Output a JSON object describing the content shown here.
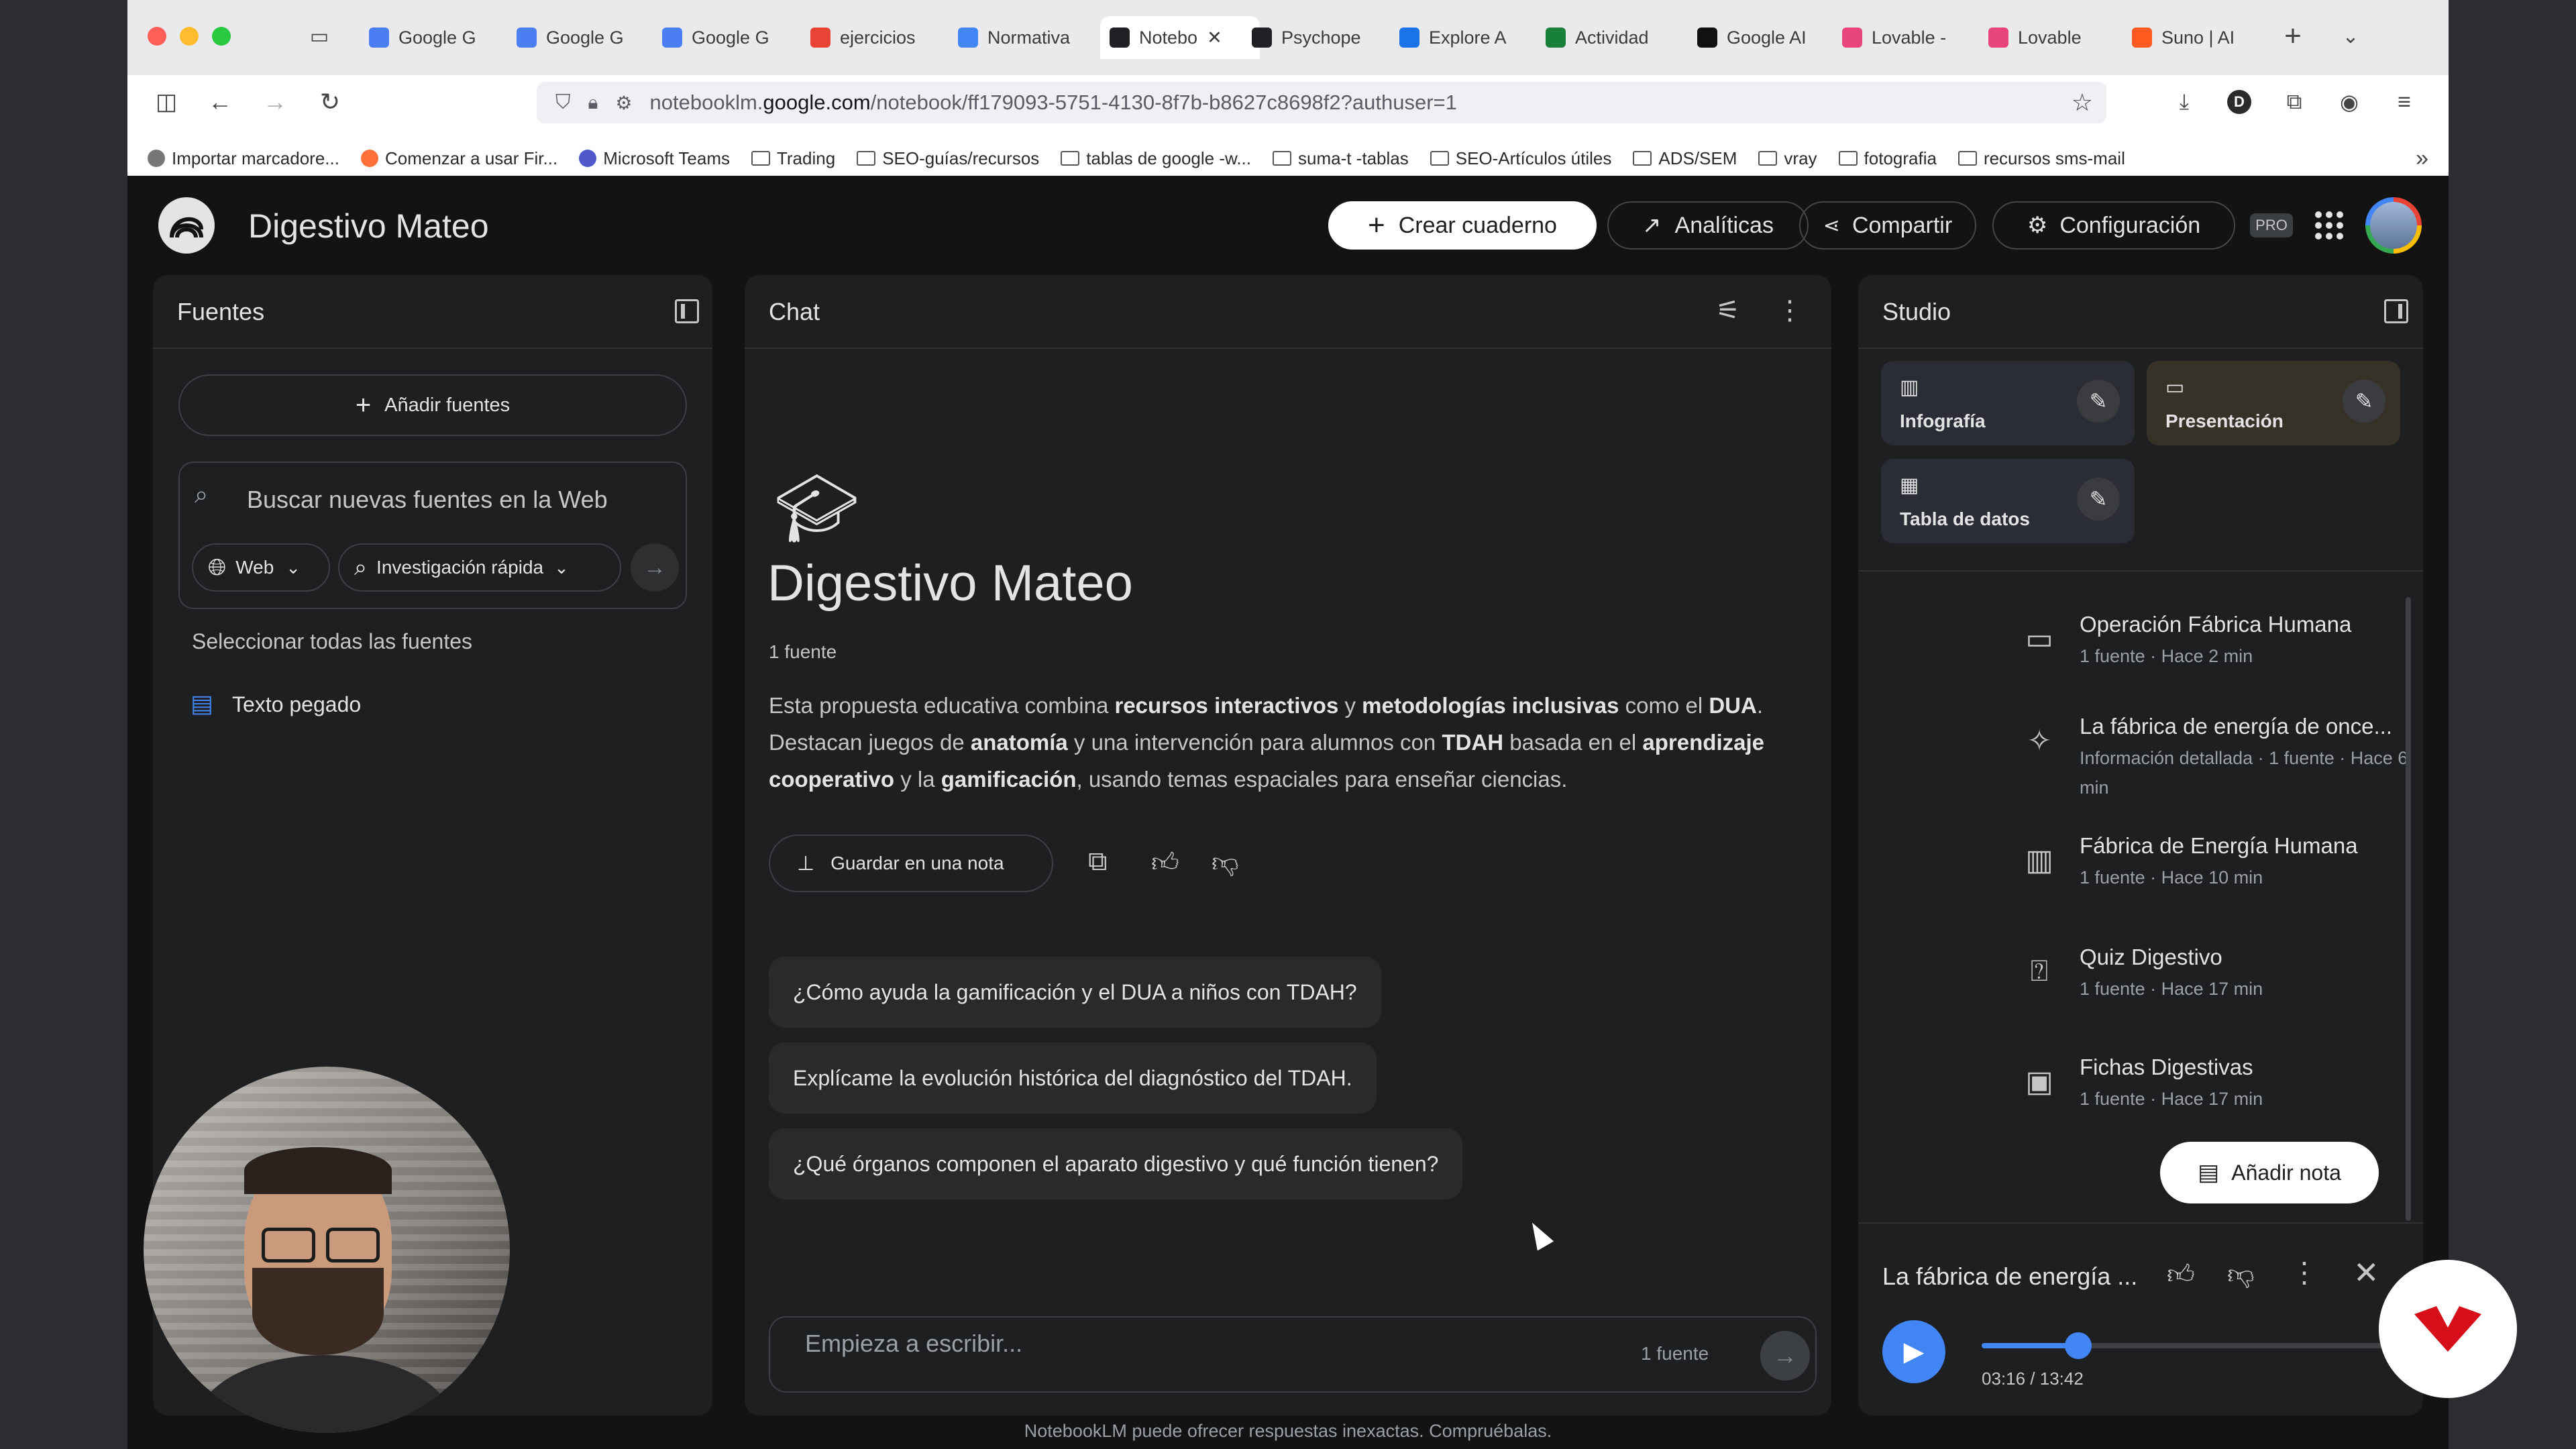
{
  "browser": {
    "tabs": [
      {
        "label": "Google G",
        "icon": "gemini-icon",
        "color": "#4c7ef3"
      },
      {
        "label": "Google G",
        "icon": "gemini-icon",
        "color": "#4c7ef3"
      },
      {
        "label": "Google G",
        "icon": "gemini-icon",
        "color": "#4c7ef3"
      },
      {
        "label": "ejercicios",
        "icon": "google-icon",
        "color": "#ea4335"
      },
      {
        "label": "Normativa",
        "icon": "docs-icon",
        "color": "#4285f4"
      },
      {
        "label": "Notebo",
        "icon": "notebooklm-icon",
        "color": "#202124"
      },
      {
        "label": "Psychope",
        "icon": "notebooklm-icon",
        "color": "#202124"
      },
      {
        "label": "Explore A",
        "icon": "forms-icon",
        "color": "#1a73e8"
      },
      {
        "label": "Actividad",
        "icon": "sheets-icon",
        "color": "#188038"
      },
      {
        "label": "Google AI",
        "icon": "ai-studio-icon",
        "color": "#111111"
      },
      {
        "label": "Lovable -",
        "icon": "lovable-icon",
        "color": "#e8457c"
      },
      {
        "label": "Lovable",
        "icon": "lovable-icon",
        "color": "#e8457c"
      },
      {
        "label": "Suno | AI",
        "icon": "suno-icon",
        "color": "#ff5a1f"
      }
    ],
    "url_prefix": "notebooklm.",
    "url_domain": "google.com",
    "url_path": "/notebook/ff179093-5751-4130-8f7b-b8627c8698f2?authuser=1",
    "profile_letter": "D",
    "bookmarks": [
      {
        "label": "Importar marcadore...",
        "icon": "import-icon"
      },
      {
        "label": "Comenzar a usar Fir...",
        "icon": "firefox-icon"
      },
      {
        "label": "Microsoft Teams",
        "icon": "teams-icon"
      },
      {
        "label": "Trading",
        "icon": "folder-icon"
      },
      {
        "label": "SEO-guías/recursos",
        "icon": "folder-icon"
      },
      {
        "label": "tablas de google -w...",
        "icon": "folder-icon"
      },
      {
        "label": "suma-t -tablas",
        "icon": "folder-icon"
      },
      {
        "label": "SEO-Artículos útiles",
        "icon": "folder-icon"
      },
      {
        "label": "ADS/SEM",
        "icon": "folder-icon"
      },
      {
        "label": "vray",
        "icon": "folder-icon"
      },
      {
        "label": "fotografia",
        "icon": "folder-icon"
      },
      {
        "label": "recursos sms-mail",
        "icon": "folder-icon"
      }
    ]
  },
  "header": {
    "notebook_title": "Digestivo Mateo",
    "create_label": "Crear cuaderno",
    "analytics_label": "Analíticas",
    "share_label": "Compartir",
    "settings_label": "Configuración",
    "pro_badge": "PRO"
  },
  "sources": {
    "title": "Fuentes",
    "add_label": "Añadir fuentes",
    "search_placeholder": "Buscar nuevas fuentes en la Web",
    "web_label": "Web",
    "research_label": "Investigación rápida",
    "select_all_label": "Seleccionar todas las fuentes",
    "items": [
      {
        "label": "Texto pegado"
      }
    ]
  },
  "chat": {
    "title": "Chat",
    "notebook_title": "Digestivo Mateo",
    "source_count": "1 fuente",
    "summary": {
      "p1": "Esta propuesta educativa combina ",
      "b1": "recursos interactivos",
      "p2": " y ",
      "b2": "metodologías inclusivas",
      "p3": " como el ",
      "b3": "DUA",
      "p4": ". Destacan juegos de ",
      "b4": "anatomía",
      "p5": " y una intervención para alumnos con ",
      "b5": "TDAH",
      "p6": " basada en el ",
      "b6": "aprendizaje cooperativo",
      "p7": " y la ",
      "b7": "gamificación",
      "p8": ", usando temas espaciales para enseñar ciencias."
    },
    "save_note_label": "Guardar en una nota",
    "suggestions": [
      "¿Cómo ayuda la gamificación y el DUA a niños con TDAH?",
      "Explícame la evolución histórica del diagnóstico del TDAH.",
      "¿Qué órganos componen el aparato digestivo y qué función tienen?"
    ],
    "input_placeholder": "Empieza a escribir...",
    "input_source_count": "1 fuente"
  },
  "studio": {
    "title": "Studio",
    "tiles": [
      {
        "label": "Infografía",
        "icon": "infographic-icon"
      },
      {
        "label": "Presentación",
        "icon": "slides-icon"
      },
      {
        "label": "Tabla de datos",
        "icon": "table-icon"
      }
    ],
    "notes": [
      {
        "title": "Operación Fábrica Humana",
        "subtitle": "1 fuente · Hace 2 min",
        "icon": "video-icon"
      },
      {
        "title": "La fábrica de energía de once...",
        "subtitle": "Información detallada · 1 fuente · Hace 6 min",
        "icon": "audio-overview-icon"
      },
      {
        "title": "Fábrica de Energía Humana",
        "subtitle": "1 fuente · Hace 10 min",
        "icon": "chart-icon"
      },
      {
        "title": "Quiz Digestivo",
        "subtitle": "1 fuente · Hace 17 min",
        "icon": "quiz-icon"
      },
      {
        "title": "Fichas Digestivas",
        "subtitle": "1 fuente · Hace 17 min",
        "icon": "flashcards-icon"
      }
    ],
    "add_note_label": "Añadir nota",
    "player": {
      "title": "La fábrica de energía ...",
      "time": "03:16 / 13:42",
      "progress": 0.24
    }
  },
  "footer": {
    "disclaimer": "NotebookLM puede ofrecer respuestas inexactas. Compruébalas."
  }
}
